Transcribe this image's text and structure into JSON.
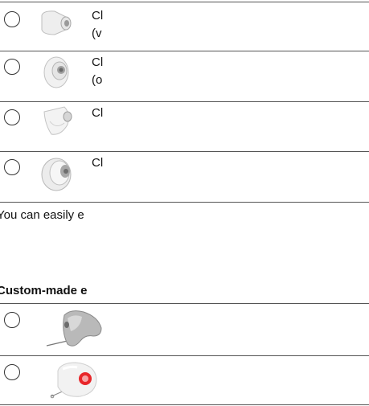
{
  "options": [
    {
      "line1": "Cl",
      "line2": "(v"
    },
    {
      "line1": "Cl",
      "line2": "(o"
    },
    {
      "line1": "Cl"
    },
    {
      "line1": "Cl"
    }
  ],
  "note": "You can easily e",
  "custom_heading": "Custom-made e",
  "accent_color": "#e8262a"
}
